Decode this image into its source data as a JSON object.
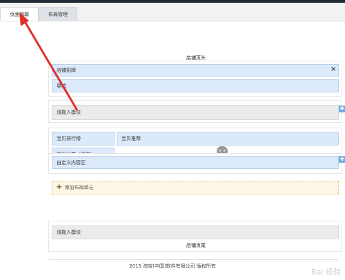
{
  "tabs": [
    {
      "label": "页面编辑",
      "active": true
    },
    {
      "label": "布局管理",
      "active": false
    }
  ],
  "header_module": {
    "title": "店铺页头",
    "signboard": "店铺招牌",
    "nav": "导航"
  },
  "modules": {
    "add_module_1": "请拖入模块",
    "rank_list": "宝贝排行榜",
    "category": "宝贝分类（竖向）",
    "recommend": "宝贝推荐",
    "custom_area": "自定义内容区",
    "add_layout": "添加布局单元",
    "add_module_2": "请拖入模块"
  },
  "footer_module": {
    "title": "店铺页尾"
  },
  "footer": {
    "copyright": "2015 淘宝(中国)软件有限公司 版权所有"
  },
  "watermark": "Bai 经验",
  "colors": {
    "accent_blue": "#dbe9fa",
    "arrow_red": "#e0302a"
  }
}
